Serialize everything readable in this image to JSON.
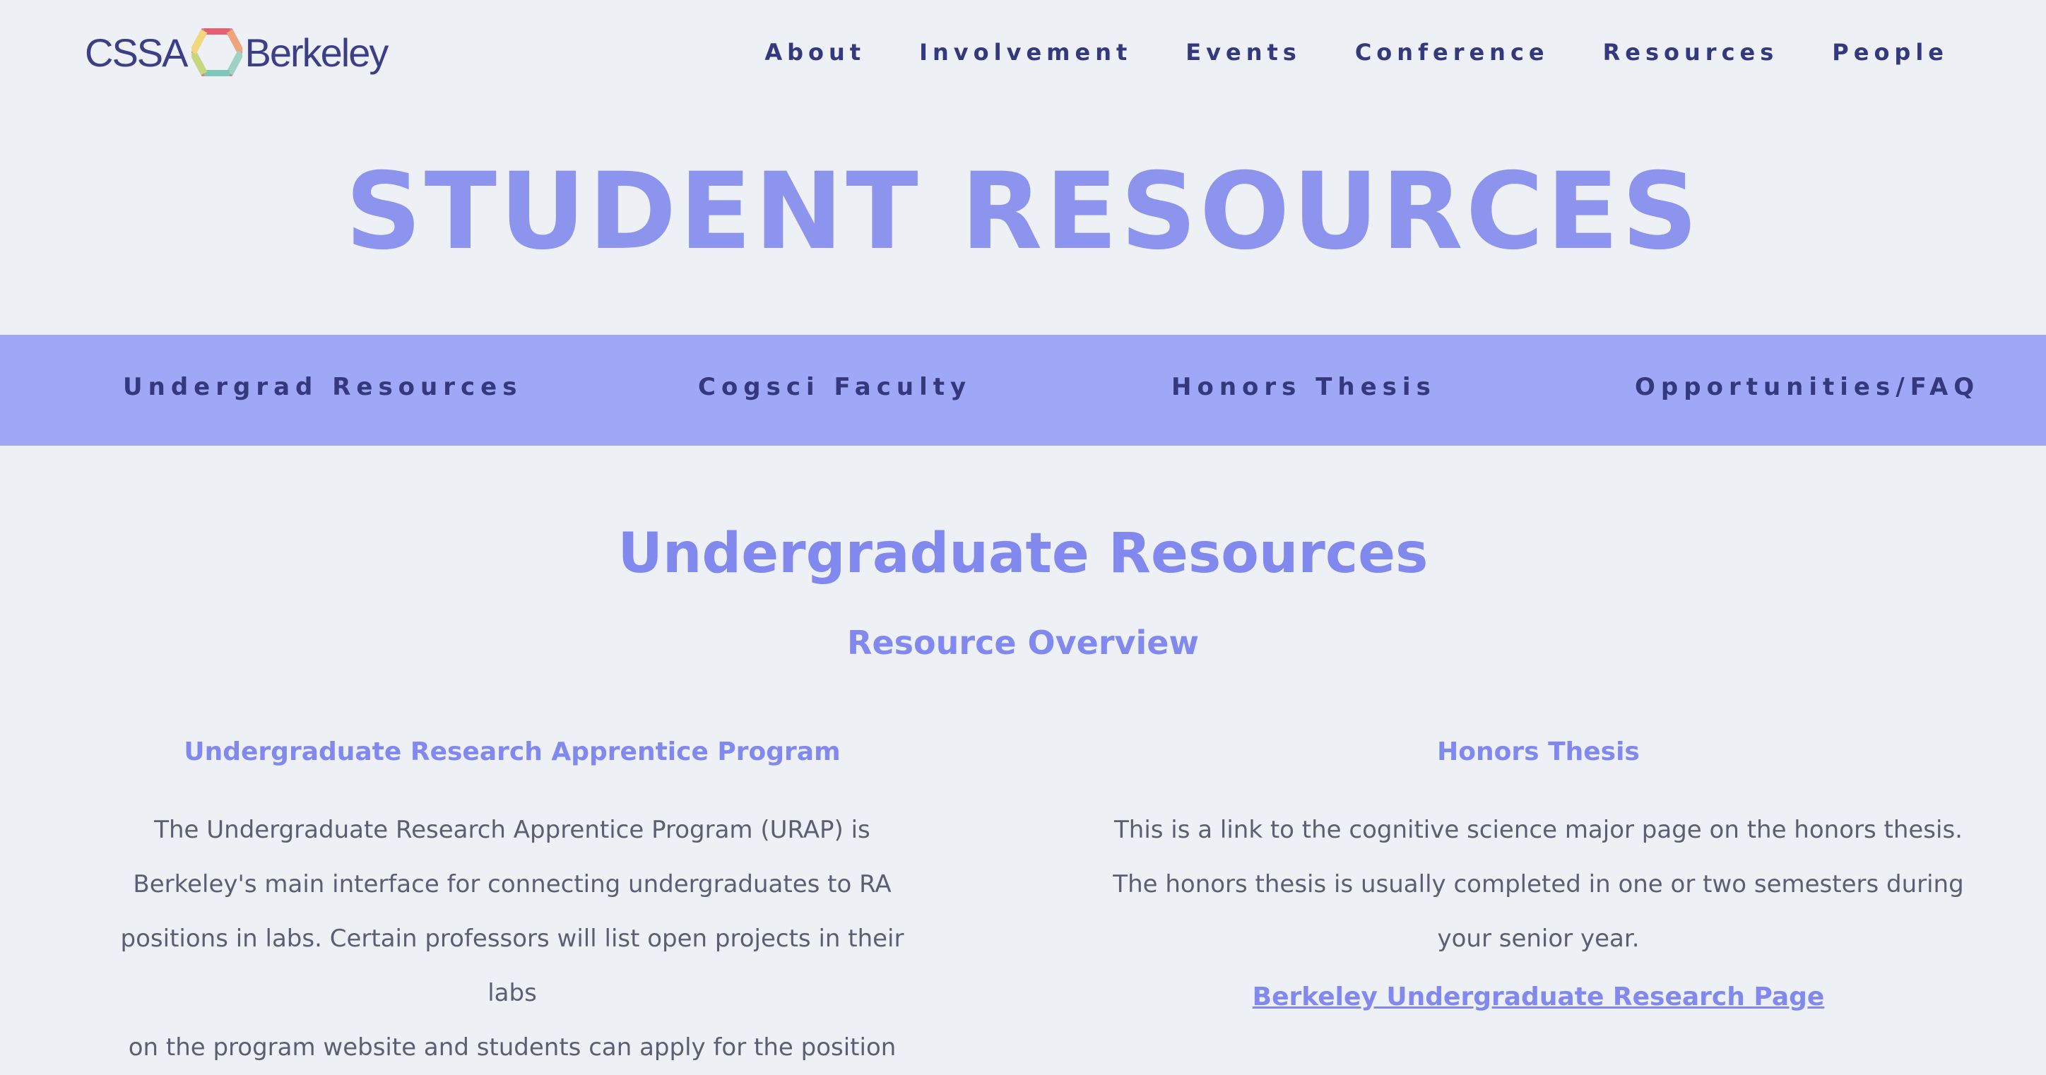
{
  "header": {
    "logo": {
      "left_text": "CSSA",
      "right_text": "Berkeley",
      "icon": "hexagon-logo-icon"
    },
    "nav": [
      "About",
      "Involvement",
      "Events",
      "Conference",
      "Resources",
      "People"
    ]
  },
  "page_title": "STUDENT RESOURCES",
  "subnav": [
    "Undergrad Resources",
    "Cogsci Faculty",
    "Honors Thesis",
    "Opportunities/FAQ"
  ],
  "section": {
    "title": "Undergraduate Resources",
    "subtitle": "Resource Overview"
  },
  "columns": {
    "left": {
      "heading": "Undergraduate Research Apprentice Program",
      "lines": [
        "The Undergraduate Research Apprentice Program (URAP) is",
        "Berkeley's main interface for connecting undergraduates to RA",
        "positions in labs. Certain professors will list open projects in their labs",
        "on the program website and students can apply for the position"
      ]
    },
    "right": {
      "heading": "Honors Thesis",
      "lines": [
        "This is a link to the cognitive science major page on the honors thesis.",
        "The honors thesis is usually completed in one or two semesters during",
        "your senior year."
      ],
      "link": "Berkeley Undergraduate Research Page"
    }
  },
  "colors": {
    "background": "#edf0f5",
    "accent": "#8289ee",
    "subnav_bg": "#9ea8f7",
    "nav_text": "#34387d"
  }
}
